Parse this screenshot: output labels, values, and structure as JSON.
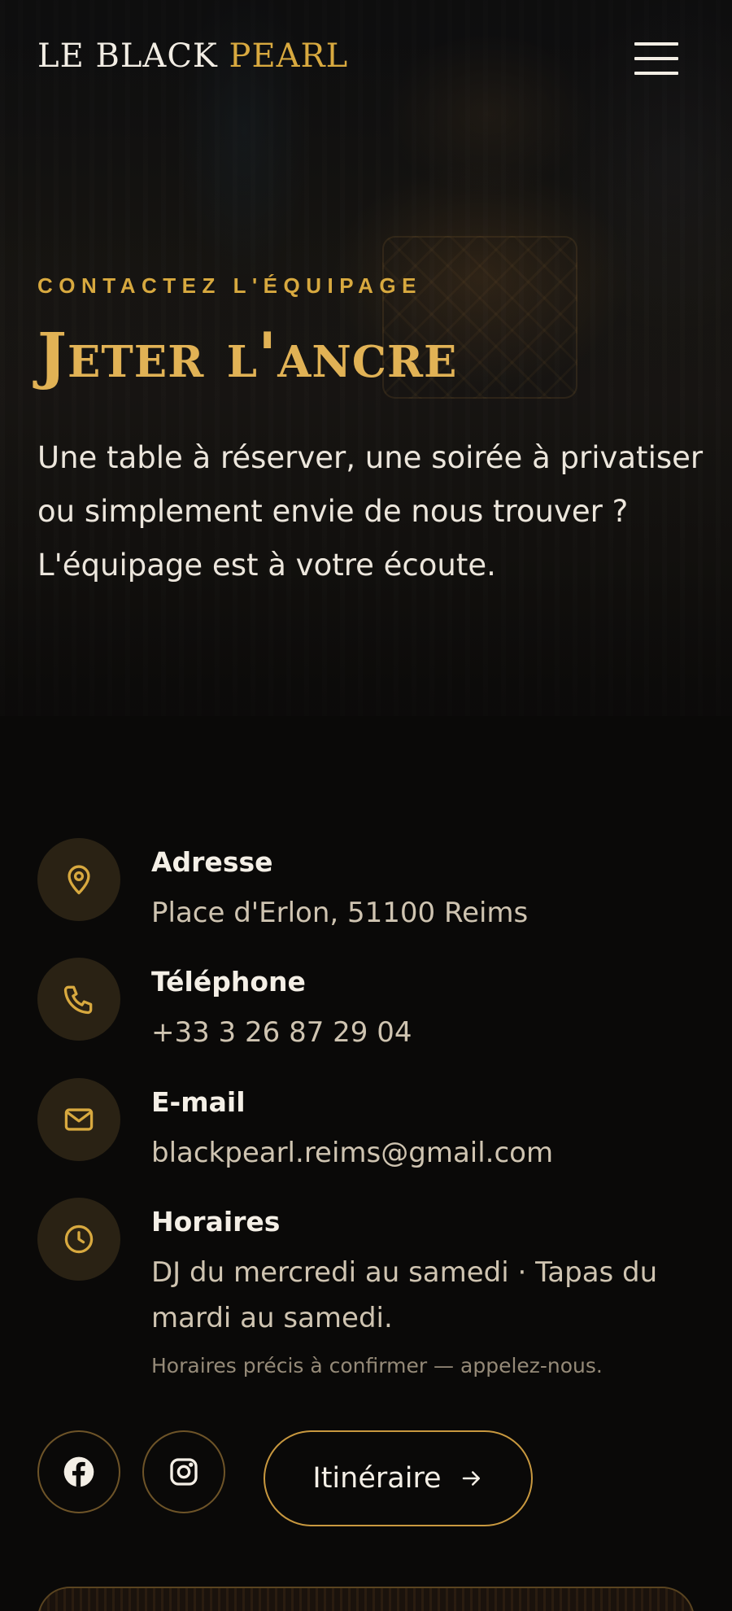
{
  "header": {
    "brand_primary": "LE BLACK",
    "brand_accent": "PEARL",
    "menu_icon": "hamburger-icon"
  },
  "hero": {
    "eyebrow": "CONTACTEZ L'ÉQUIPAGE",
    "title": "Jeter l'ancre",
    "lead": "Une table à réserver, une soirée à privatiser ou simplement envie de nous trouver ? L'équipage est à votre écoute."
  },
  "contact": {
    "items": [
      {
        "icon": "map-pin-icon",
        "label": "Adresse",
        "value": "Place d'Erlon, 51100 Reims"
      },
      {
        "icon": "phone-icon",
        "label": "Téléphone",
        "value": "+33 3 26 87 29 04"
      },
      {
        "icon": "mail-icon",
        "label": "E-mail",
        "value": "blackpearl.reims@gmail.com"
      },
      {
        "icon": "clock-icon",
        "label": "Horaires",
        "value": "DJ du mercredi au samedi · Tapas du mardi au samedi.",
        "note": "Horaires précis à confirmer — appelez-nous."
      }
    ]
  },
  "actions": {
    "facebook_icon": "facebook-icon",
    "instagram_icon": "instagram-icon",
    "route_label": "Itinéraire",
    "route_icon": "arrow-right-icon"
  },
  "colors": {
    "accent": "#d8a93f",
    "background": "#0a0908",
    "icon_bg": "#2a2214"
  }
}
